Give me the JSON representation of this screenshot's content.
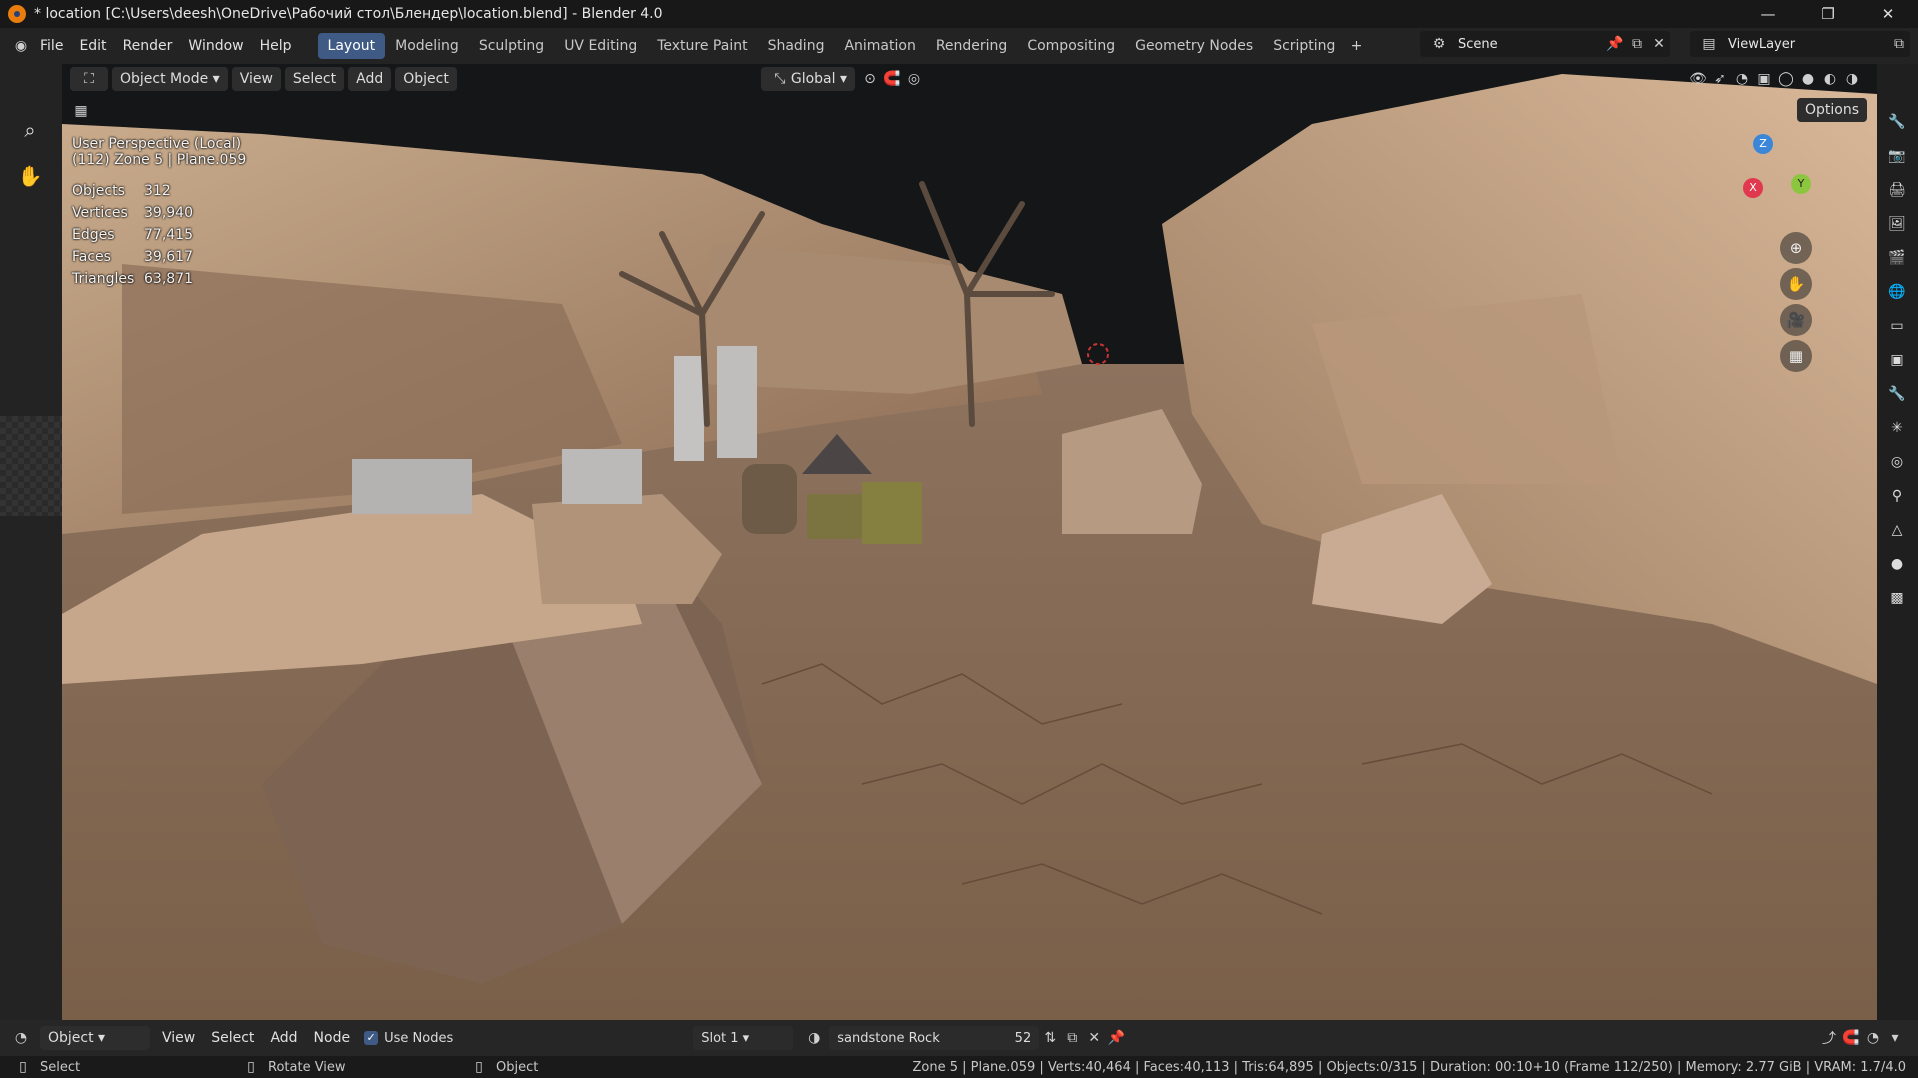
{
  "title": "* location [C:\\Users\\deesh\\OneDrive\\Рабочий стол\\Блендер\\location.blend] - Blender 4.0",
  "window_controls": {
    "minimize": "—",
    "maximize": "❐",
    "close": "✕"
  },
  "menu": {
    "file": "File",
    "edit": "Edit",
    "render": "Render",
    "window": "Window",
    "help": "Help"
  },
  "workspaces": [
    "Layout",
    "Modeling",
    "Sculpting",
    "UV Editing",
    "Texture Paint",
    "Shading",
    "Animation",
    "Rendering",
    "Compositing",
    "Geometry Nodes",
    "Scripting"
  ],
  "add_workspace": "+",
  "scene": "Scene",
  "view_layer": "ViewLayer",
  "viewport_header": {
    "mode": "Object Mode",
    "view": "View",
    "select": "Select",
    "add": "Add",
    "object": "Object",
    "orientation": "Global",
    "options": "Options"
  },
  "overlay": {
    "perspective": "User Perspective (Local)",
    "object_info": "(112) Zone 5 | Plane.059",
    "stats": [
      {
        "label": "Objects",
        "value": "312"
      },
      {
        "label": "Vertices",
        "value": "39,940"
      },
      {
        "label": "Edges",
        "value": "77,415"
      },
      {
        "label": "Faces",
        "value": "39,617"
      },
      {
        "label": "Triangles",
        "value": "63,871"
      }
    ]
  },
  "gizmo": {
    "z": "Z",
    "x": "X",
    "y": "Y"
  },
  "node_header": {
    "context": "Object",
    "view": "View",
    "select": "Select",
    "add": "Add",
    "node": "Node",
    "use_nodes": "Use Nodes",
    "slot": "Slot 1",
    "material": "sandstone Rock",
    "users": "52"
  },
  "status": {
    "left": "Select",
    "middle": "Rotate View",
    "right_ctx": "Object",
    "info": "Zone 5 | Plane.059 | Verts:40,464 | Faces:40,113 | Tris:64,895 | Objects:0/315 | Duration: 00:10+10 (Frame 112/250) | Memory: 2.77 GiB | VRAM: 1.7/4.0"
  },
  "colors": {
    "accent": "#3f5a84",
    "blender_orange": "#e87d0d",
    "axis_x": "#e0384e",
    "axis_y": "#8cc63f",
    "axis_z": "#3b86d6"
  }
}
